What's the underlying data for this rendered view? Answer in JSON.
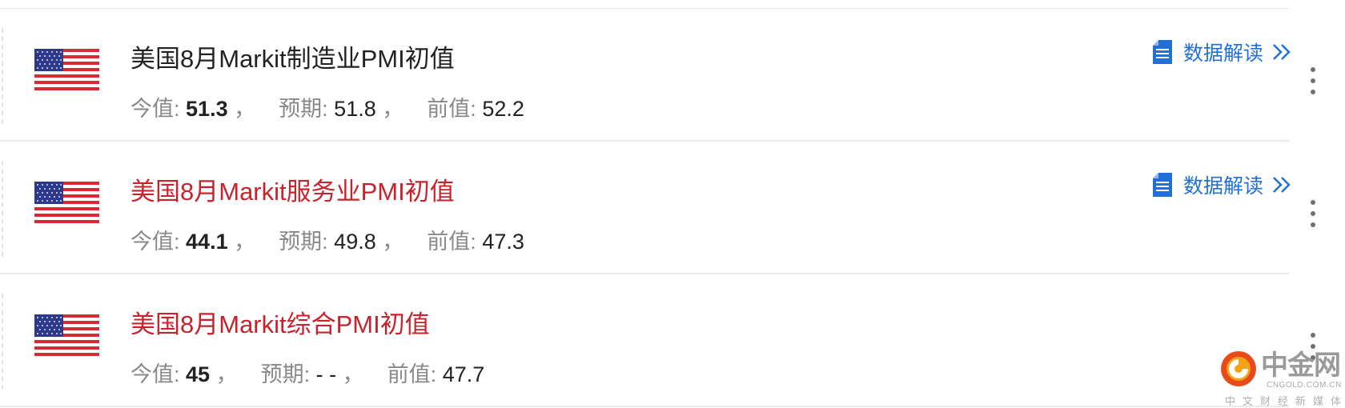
{
  "events": [
    {
      "flag": "us-flag-icon",
      "title": "美国8月Markit制造业PMI初值",
      "title_color": "#222222",
      "actual_label": "今值:",
      "actual": "51.3",
      "forecast_label": "预期:",
      "forecast": "51.8",
      "previous_label": "前值:",
      "previous": "52.2",
      "sep": "，",
      "interpretation_link": "数据解读"
    },
    {
      "flag": "us-flag-icon",
      "title": "美国8月Markit服务业PMI初值",
      "title_color": "#c8232c",
      "actual_label": "今值:",
      "actual": "44.1",
      "forecast_label": "预期:",
      "forecast": "49.8",
      "previous_label": "前值:",
      "previous": "47.3",
      "sep": "，",
      "interpretation_link": "数据解读"
    },
    {
      "flag": "us-flag-icon",
      "title": "美国8月Markit综合PMI初值",
      "title_color": "#c8232c",
      "actual_label": "今值:",
      "actual": "45",
      "forecast_label": "预期:",
      "forecast": "- -",
      "previous_label": "前值:",
      "previous": "47.7",
      "sep": "，"
    }
  ],
  "watermark": {
    "name_cn": "中金网",
    "domain": "CNGOLD.COM.CN",
    "tagline": "中文财经新媒体"
  },
  "colors": {
    "link": "#2170d8",
    "highlight_title": "#c8232c",
    "label_gray": "#888888"
  }
}
